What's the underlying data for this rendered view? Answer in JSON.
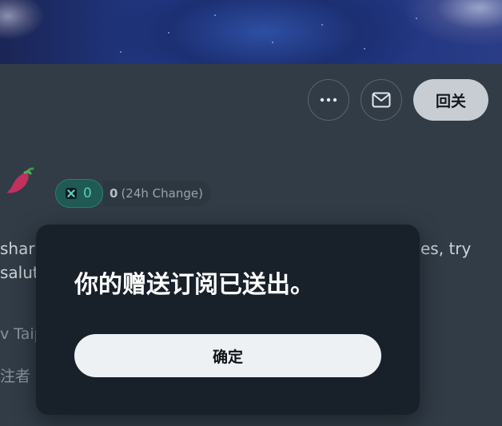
{
  "header": {
    "more_icon": "more-horizontal-icon",
    "mail_icon": "mail-icon",
    "follow_label": "回关"
  },
  "profile": {
    "badge_icon": "chili-pepper-icon",
    "coin_count": "0",
    "change_value": "0",
    "change_label": "(24h Change)",
    "bio_left_line1": "shar",
    "bio_right_line1": "es, try",
    "bio_left_line2": "salut",
    "location_fragment": "v Taip",
    "followers_fragment": "注者"
  },
  "dialog": {
    "message": "你的赠送订阅已送出。",
    "confirm_label": "确定"
  },
  "colors": {
    "background": "#313c47",
    "dialog_bg": "#18202a",
    "accent_teal": "#55cdb7"
  }
}
